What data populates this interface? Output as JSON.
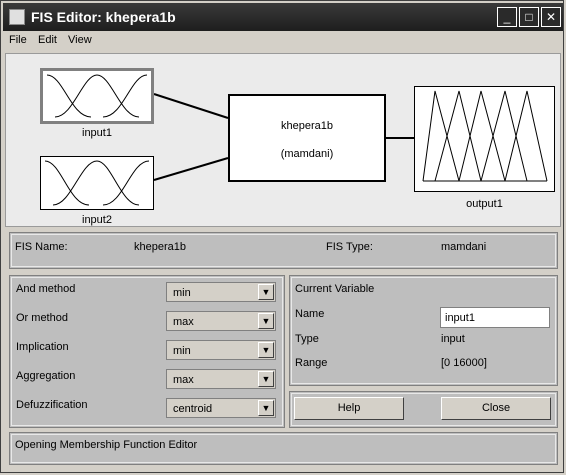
{
  "window": {
    "title": "FIS Editor: khepera1b",
    "minimize": "_",
    "maximize": "□",
    "close": "✕"
  },
  "menu": [
    "File",
    "Edit",
    "View"
  ],
  "diagram": {
    "input1_label": "input1",
    "input2_label": "input2",
    "output1_label": "output1",
    "system_name": "khepera1b",
    "system_type": "(mamdani)"
  },
  "info": {
    "fis_name_label": "FIS Name:",
    "fis_name": "khepera1b",
    "fis_type_label": "FIS Type:",
    "fis_type": "mamdani"
  },
  "methods": [
    {
      "label": "And method",
      "value": "min"
    },
    {
      "label": "Or method",
      "value": "max"
    },
    {
      "label": "Implication",
      "value": "min"
    },
    {
      "label": "Aggregation",
      "value": "max"
    },
    {
      "label": "Defuzzification",
      "value": "centroid"
    }
  ],
  "current_variable": {
    "heading": "Current Variable",
    "name_label": "Name",
    "name_value": "input1",
    "type_label": "Type",
    "type_value": "input",
    "range_label": "Range",
    "range_value": "[0 16000]"
  },
  "buttons": {
    "help": "Help",
    "close": "Close"
  },
  "status": "Opening Membership Function Editor",
  "colors": {
    "titlebar": "#1e1e1e",
    "panel": "#bebebe",
    "background": "#d4d0c8"
  }
}
